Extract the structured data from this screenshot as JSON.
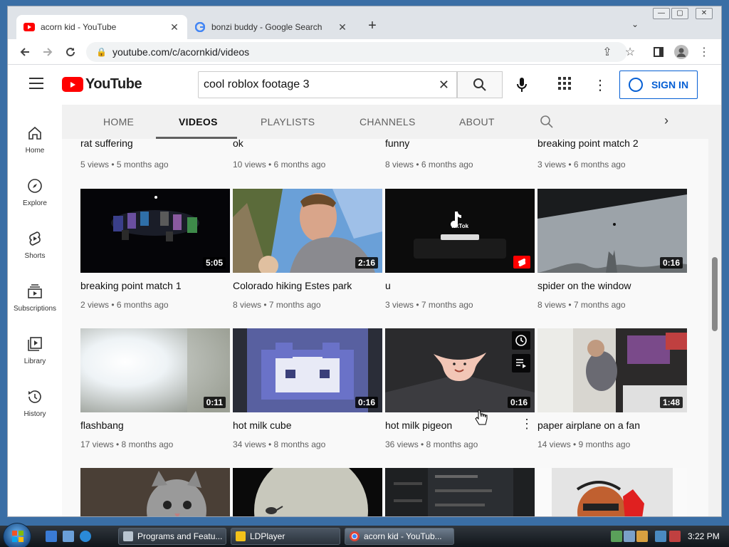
{
  "browser": {
    "tabs": [
      {
        "title": "acorn kid - YouTube",
        "active": true
      },
      {
        "title": "bonzi buddy - Google Search",
        "active": false
      }
    ],
    "url": "youtube.com/c/acornkid/videos"
  },
  "youtube": {
    "logo_text": "YouTube",
    "search_value": "cool roblox footage 3",
    "sign_in_label": "SIGN IN",
    "guide": [
      {
        "label": "Home"
      },
      {
        "label": "Explore"
      },
      {
        "label": "Shorts"
      },
      {
        "label": "Subscriptions"
      },
      {
        "label": "Library"
      },
      {
        "label": "History"
      }
    ],
    "channel_tabs": [
      "HOME",
      "VIDEOS",
      "PLAYLISTS",
      "CHANNELS",
      "ABOUT"
    ],
    "partial_row": [
      {
        "title": "rat suffering",
        "meta": "5 views • 5 months ago"
      },
      {
        "title": "ok",
        "meta": "10 views • 6 months ago"
      },
      {
        "title": "funny",
        "meta": "8 views • 6 months ago"
      },
      {
        "title": "breaking point match 2",
        "meta": "3 views • 6 months ago"
      }
    ],
    "row1": [
      {
        "title": "breaking point match 1",
        "meta": "2 views • 6 months ago",
        "duration": "5:05"
      },
      {
        "title": "Colorado hiking Estes park",
        "meta": "8 views • 7 months ago",
        "duration": "2:16"
      },
      {
        "title": "u",
        "meta": "3 views • 7 months ago",
        "duration": ""
      },
      {
        "title": "spider on the window",
        "meta": "8 views • 7 months ago",
        "duration": "0:16"
      }
    ],
    "row2": [
      {
        "title": "flashbang",
        "meta": "17 views • 8 months ago",
        "duration": "0:11"
      },
      {
        "title": "hot milk cube",
        "meta": "34 views • 8 months ago",
        "duration": "0:16"
      },
      {
        "title": "hot milk pigeon",
        "meta": "36 views • 8 months ago",
        "duration": "0:16"
      },
      {
        "title": "paper airplane on a fan",
        "meta": "14 views • 9 months ago",
        "duration": "1:48"
      }
    ],
    "tiktok_label": "TikTok"
  },
  "taskbar": {
    "items": [
      {
        "label": "Programs and Featu..."
      },
      {
        "label": "LDPlayer"
      },
      {
        "label": "acorn kid - YouTub..."
      }
    ],
    "clock": "3:22 PM"
  }
}
